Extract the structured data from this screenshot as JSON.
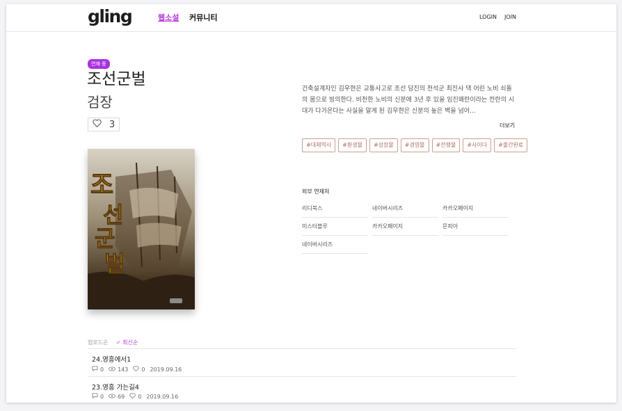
{
  "header": {
    "logo": "gling",
    "nav": [
      "웹소설",
      "커뮤니티"
    ],
    "login": "LOGIN",
    "join": "JOIN"
  },
  "novel": {
    "badge": "연재 중",
    "title": "조선군벌",
    "author": "검장",
    "likes": "3",
    "description": "건축설계자인 김우현은 교통사고로 조선 당진의 천석군 최진사 댁 어린 노비 쇠돌의 몸으로 빙의한다. 비천한 노비의 신분에 3년 후 있을 임진왜란이라는 전란의 시대가 다가온다는 사실을 알게 된 김우현은 신분의 높은 벽을 넘어…",
    "more": "더보기",
    "tags": [
      "#대체역사",
      "#환생물",
      "#성장물",
      "#경영물",
      "#전쟁물",
      "#사이다",
      "#출간완료"
    ],
    "cover_title": "조선군벌"
  },
  "external": {
    "title": "외부 연재처",
    "items": [
      "리디북스",
      "네이버시리즈",
      "카카오페이지",
      "미스터블루",
      "카카오페이지",
      "문피아",
      "네이버시리즈"
    ]
  },
  "episodes": {
    "sort_upload": "업로드순",
    "sort_latest": "✓ 최신순",
    "list": [
      {
        "title": "24.영흥에서1",
        "comments": "0",
        "views": "143",
        "likes": "0",
        "date": "2019.09.16"
      },
      {
        "title": "23.영흥 가는길4",
        "comments": "0",
        "views": "69",
        "likes": "0",
        "date": "2019.09.16"
      }
    ]
  },
  "colors": {
    "accent": "#a933e0",
    "tag": "#b07060"
  }
}
